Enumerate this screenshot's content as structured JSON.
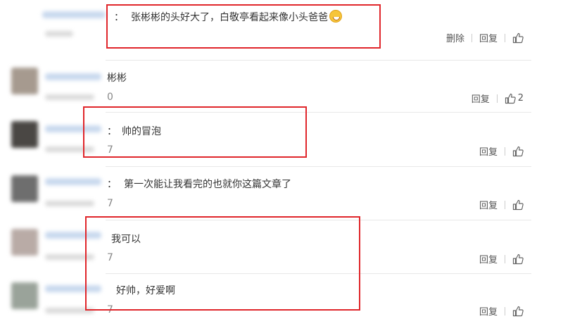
{
  "comments": [
    {
      "fragment": "：",
      "text": "张彬彬的头好大了，白敬亭看起来像小头爸爸",
      "emoji": "laughing-tears",
      "actions": [
        "删除",
        "回复"
      ],
      "likes": ""
    },
    {
      "fragment": "彬彬",
      "time_fragment": "0",
      "text": "",
      "actions": [
        "回复"
      ],
      "likes": "2"
    },
    {
      "fragment": "：",
      "time_fragment": "7",
      "text": "帅的冒泡",
      "actions": [
        "回复"
      ],
      "likes": ""
    },
    {
      "fragment": "：",
      "time_fragment": "7",
      "text": "第一次能让我看完的也就你这篇文章了",
      "actions": [
        "回复"
      ],
      "likes": ""
    },
    {
      "fragment": "",
      "time_fragment": "7",
      "text": "我可以",
      "actions": [
        "回复"
      ],
      "likes": ""
    },
    {
      "fragment": "",
      "time_fragment": "7",
      "text": "好帅，好爱啊",
      "actions": [
        "回复"
      ],
      "likes": ""
    }
  ],
  "colors": {
    "highlight_box": "#e0262b",
    "separator": "#e8e8e8"
  }
}
